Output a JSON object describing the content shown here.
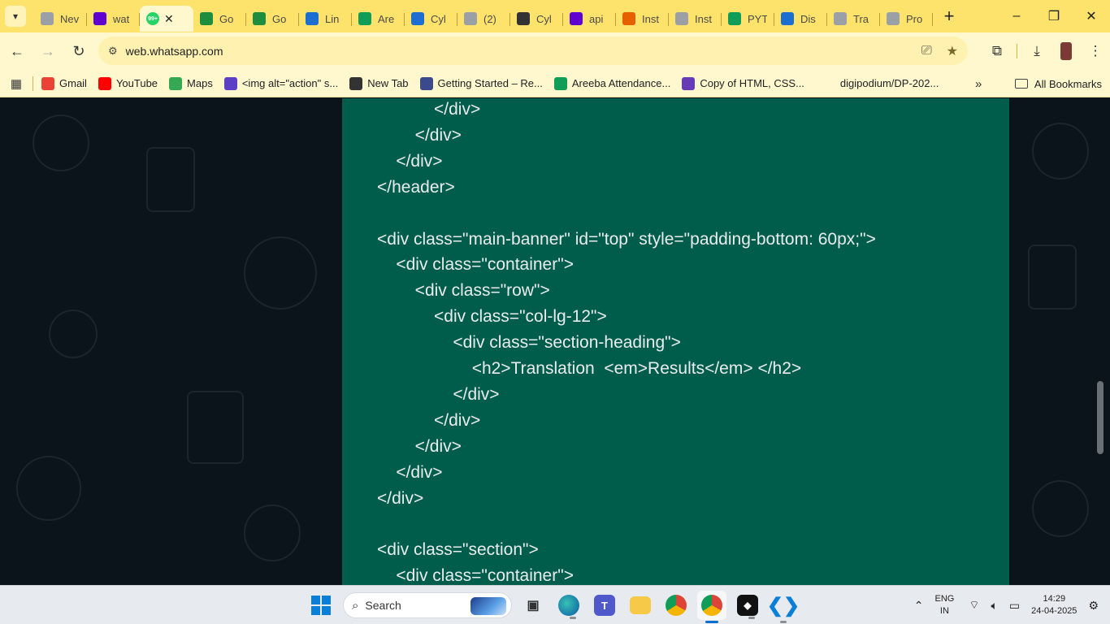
{
  "browser": {
    "tabs": [
      {
        "title": "New Tab",
        "icon": "chrome-icon",
        "color": "#9aa0a6"
      },
      {
        "title": "whatsapp - Yahoo",
        "icon": "yahoo-icon",
        "color": "#6001d2"
      },
      {
        "title": "WhatsApp",
        "icon": "whatsapp-icon",
        "color": "#25d366",
        "active": true,
        "badge": "99+"
      },
      {
        "title": "Google Classroom",
        "icon": "classroom-icon",
        "color": "#1e8e3e"
      },
      {
        "title": "Google Classroom",
        "icon": "classroom-icon",
        "color": "#1e8e3e"
      },
      {
        "title": "LinkedIn",
        "icon": "k-icon",
        "color": "#1c6fd1"
      },
      {
        "title": "Areeba Attendance",
        "icon": "sheets-icon",
        "color": "#0f9d58"
      },
      {
        "title": "Cyber",
        "icon": "k-icon",
        "color": "#1c6fd1"
      },
      {
        "title": "(2)",
        "icon": "chrome-icon",
        "color": "#9aa0a6"
      },
      {
        "title": "Cyber",
        "icon": "openai-icon",
        "color": "#333333"
      },
      {
        "title": "api",
        "icon": "yahoo-icon",
        "color": "#6001d2"
      },
      {
        "title": "Instructure",
        "icon": "instructure-icon",
        "color": "#e66000"
      },
      {
        "title": "Instagram",
        "icon": "chrome-icon",
        "color": "#9aa0a6"
      },
      {
        "title": "PYTHON",
        "icon": "sheets-icon",
        "color": "#0f9d58"
      },
      {
        "title": "Discord",
        "icon": "k-icon",
        "color": "#1c6fd1"
      },
      {
        "title": "Translate",
        "icon": "chrome-icon",
        "color": "#9aa0a6"
      },
      {
        "title": "Profile",
        "icon": "chrome-icon",
        "color": "#9aa0a6"
      }
    ],
    "tab_labels_visible": [
      "Nev",
      "wat",
      "",
      "Go",
      "Go",
      "Lin",
      "Are",
      "Cyl",
      "(2)",
      "Cyl",
      "api",
      "Inst",
      "Inst",
      "PYT",
      "Dis",
      "Tra",
      "Pro"
    ],
    "address": "web.whatsapp.com",
    "bookmarks": [
      {
        "label": "Gmail",
        "icon": "gmail-icon",
        "color": "#ea4335"
      },
      {
        "label": "YouTube",
        "icon": "youtube-icon",
        "color": "#ff0000"
      },
      {
        "label": "Maps",
        "icon": "maps-icon",
        "color": "#34a853"
      },
      {
        "label": "<img alt=\"action\" s...",
        "icon": "github-icon",
        "color": "#5b3fc4"
      },
      {
        "label": "New Tab",
        "icon": "globe-icon",
        "color": "#333333"
      },
      {
        "label": "Getting Started – Re...",
        "icon": "react-icon",
        "color": "#3b4a8c"
      },
      {
        "label": "Areeba Attendance...",
        "icon": "sheets-icon",
        "color": "#0f9d58"
      },
      {
        "label": "Copy of HTML, CSS...",
        "icon": "forms-icon",
        "color": "#673ab7"
      },
      {
        "label": "digipodium/DP-202...",
        "icon": "",
        "color": ""
      }
    ],
    "all_bookmarks_label": "All Bookmarks"
  },
  "code_view": {
    "lines": [
      "            </div>",
      "        </div>",
      "    </div>",
      "</header>",
      "",
      "<div class=\"main-banner\" id=\"top\" style=\"padding-bottom: 60px;\">",
      "    <div class=\"container\">",
      "        <div class=\"row\">",
      "            <div class=\"col-lg-12\">",
      "                <div class=\"section-heading\">",
      "                    <h2>Translation  <em>Results</em> </h2>",
      "                </div>",
      "            </div>",
      "        </div>",
      "    </div>",
      "</div>",
      "",
      "<div class=\"section\">",
      "    <div class=\"container\">"
    ]
  },
  "taskbar": {
    "search_label": "Search",
    "lang_top": "ENG",
    "lang_bottom": "IN",
    "time": "14:29",
    "date": "24-04-2025"
  },
  "colors": {
    "tab_strip": "#fde26b",
    "chat_bubble": "#005c4b",
    "chat_background": "#0b141a"
  }
}
